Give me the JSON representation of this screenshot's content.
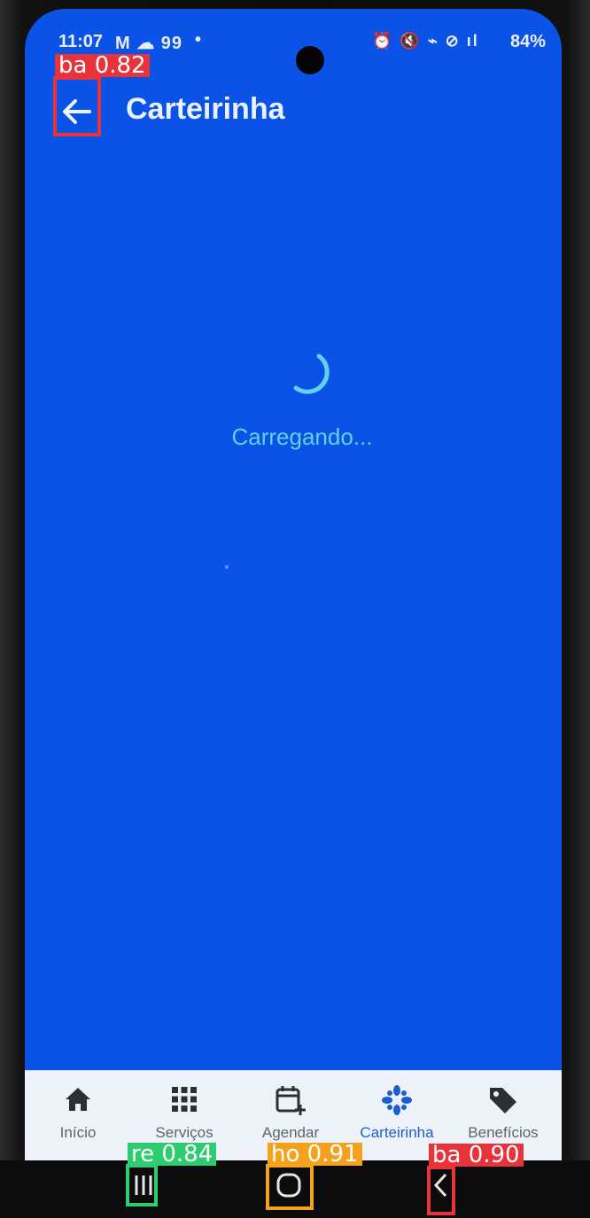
{
  "status_bar": {
    "time": "11:07",
    "left_icons_text": "M",
    "notification_count": "99",
    "dot": "•",
    "right_icons_text": "⏰ 🔇 ⌁ ⊘ ıl",
    "battery": "84%"
  },
  "app_bar": {
    "title": "Carteirinha",
    "back_icon": "arrow-left-icon"
  },
  "loading": {
    "text": "Carregando..."
  },
  "bottom_nav": {
    "items": [
      {
        "label": "Início",
        "icon": "home-icon"
      },
      {
        "label": "Serviços",
        "icon": "grid-icon"
      },
      {
        "label": "Agendar",
        "icon": "calendar-add-icon"
      },
      {
        "label": "Carteirinha",
        "icon": "card-icon",
        "active": true
      },
      {
        "label": "Benefícios",
        "icon": "tag-icon"
      }
    ]
  },
  "system_nav": {
    "recents_icon": "recents-icon",
    "home_icon": "home-circle-icon",
    "back_icon": "back-chevron-icon"
  },
  "detections": [
    {
      "label": "ba 0.82",
      "color": "#e8333a"
    },
    {
      "label": "re 0.84",
      "color": "#2ecc71"
    },
    {
      "label": "ho 0.91",
      "color": "#f4a21d"
    },
    {
      "label": "ba 0.90",
      "color": "#e8333a"
    }
  ],
  "colors": {
    "screen_bg": "#0b52e6",
    "accent": "#63d0ef",
    "nav_bg": "#eef3f9"
  }
}
